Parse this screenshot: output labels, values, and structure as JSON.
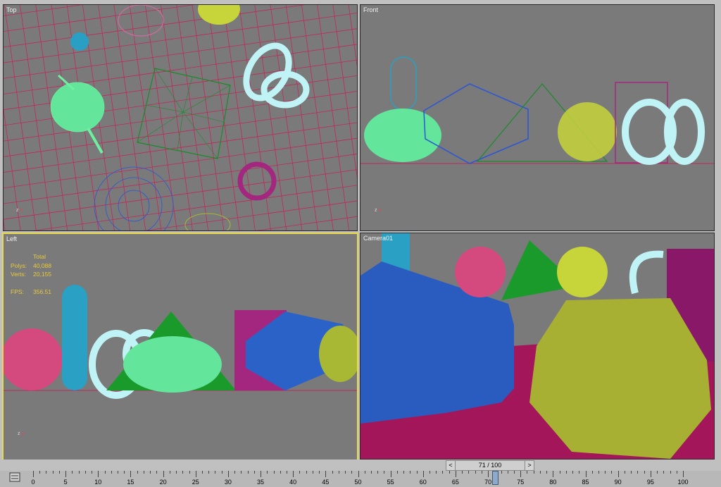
{
  "viewports": {
    "top": {
      "label": "Top"
    },
    "front": {
      "label": "Front"
    },
    "left": {
      "label": "Left"
    },
    "camera": {
      "label": "Camera01"
    }
  },
  "stats": {
    "total_label": "Total",
    "polys_label": "Polys:",
    "polys_value": "40,088",
    "verts_label": "Verts:",
    "verts_value": "20,155",
    "fps_label": "FPS:",
    "fps_value": "356.51"
  },
  "time_slider": {
    "prev": "<",
    "next": ">",
    "text": "71 / 100"
  },
  "track_labels": [
    "0",
    "5",
    "10",
    "15",
    "20",
    "25",
    "30",
    "35",
    "40",
    "45",
    "50",
    "55",
    "60",
    "65",
    "70",
    "75",
    "80",
    "85",
    "90",
    "95",
    "100"
  ],
  "colors": {
    "viewport_bg": "#7a7a7a",
    "active_border": "#e8d84c",
    "grid": "#c0285a"
  },
  "axes": {
    "x": "x",
    "y": "y",
    "z": "z"
  }
}
